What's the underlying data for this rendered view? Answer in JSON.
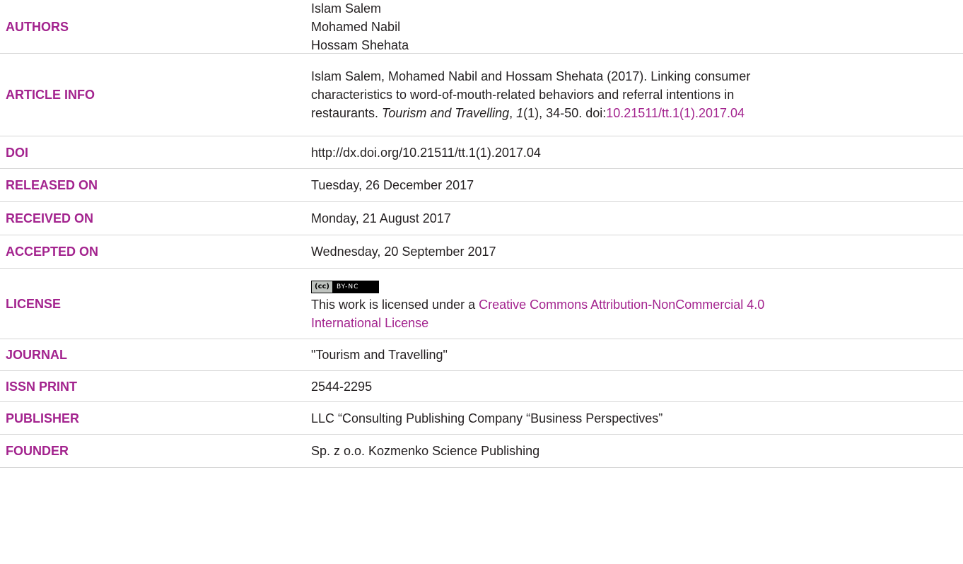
{
  "rows": {
    "authors": {
      "label": "AUTHORS",
      "names": [
        "Islam Salem",
        "Mohamed Nabil",
        "Hossam Shehata"
      ]
    },
    "article_info": {
      "label": "ARTICLE INFO",
      "line1": "Islam Salem, Mohamed Nabil and Hossam Shehata (2017). Linking consumer",
      "line2": "characteristics to word-of-mouth-related behaviors and referral intentions in",
      "line3_prefix": "restaurants. ",
      "journal_italic": "Tourism and Travelling",
      "comma": ", ",
      "volume_italic": "1",
      "issue_pages": "(1), 34-50. doi:",
      "doi_link": "10.21511/tt.1(1).2017.04"
    },
    "doi": {
      "label": "DOI",
      "value": "http://dx.doi.org/10.21511/tt.1(1).2017.04"
    },
    "released": {
      "label": "RELEASED ON",
      "value": "Tuesday, 26 December 2017"
    },
    "received": {
      "label": "RECEIVED ON",
      "value": "Monday, 21 August 2017"
    },
    "accepted": {
      "label": "ACCEPTED ON",
      "value": "Wednesday, 20 September 2017"
    },
    "license": {
      "label": "LICENSE",
      "badge_cc": "(cc)",
      "badge_terms": "BY-NC",
      "text_prefix": "This work is licensed under a ",
      "link_line1": "Creative Commons Attribution-NonCommercial 4.0",
      "link_line2": "International License"
    },
    "journal": {
      "label": "JOURNAL",
      "value": "\"Tourism and Travelling\""
    },
    "issn_print": {
      "label": "ISSN PRINT",
      "value": "2544-2295"
    },
    "publisher": {
      "label": "PUBLISHER",
      "value": "LLC “Consulting Publishing Company “Business Perspectives”"
    },
    "founder": {
      "label": "FOUNDER",
      "value": "Sp. z o.o. Kozmenko Science Publishing"
    }
  },
  "colors": {
    "label": "#a3238e",
    "text": "#231f20",
    "divider": "#d6d6d6"
  }
}
